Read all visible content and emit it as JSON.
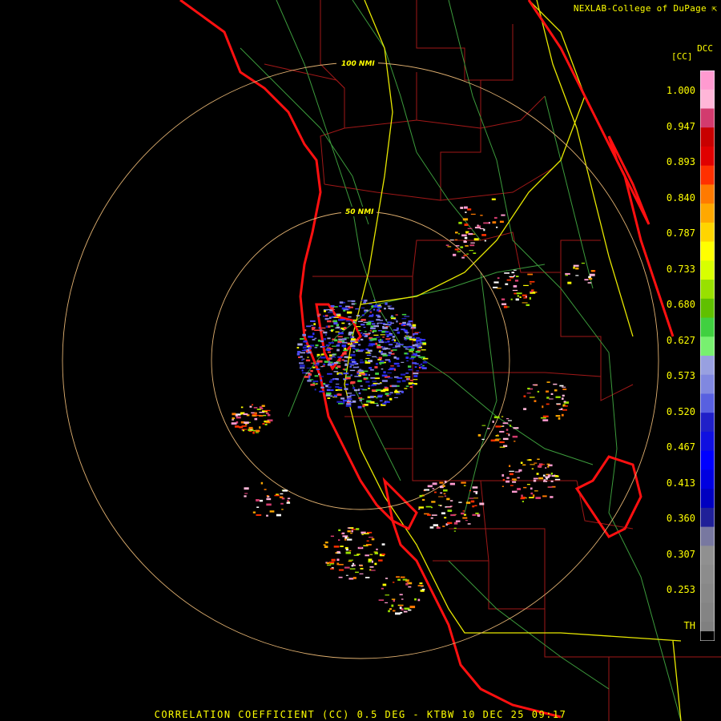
{
  "header": {
    "credit": "NEXLAB-College of DuPage",
    "credit_icon": "cursor-arrow-icon",
    "product_code": "DCC",
    "unit": "[CC]"
  },
  "legend": {
    "labels": [
      "1.000",
      "0.947",
      "0.893",
      "0.840",
      "0.787",
      "0.733",
      "0.680",
      "0.627",
      "0.573",
      "0.520",
      "0.467",
      "0.413",
      "0.360",
      "0.307",
      "0.253",
      "TH"
    ],
    "colors": [
      "#ff9ad0",
      "#ffb6d8",
      "#d23b6e",
      "#c80000",
      "#e00000",
      "#ff3000",
      "#ff7a00",
      "#ffa800",
      "#ffd500",
      "#ffff00",
      "#d8ff00",
      "#98e000",
      "#60c000",
      "#40d040",
      "#78f070",
      "#98a0e0",
      "#8088e0",
      "#5860e0",
      "#2020c8",
      "#1010e0",
      "#0000ff",
      "#0000e0",
      "#0000c0",
      "#202098",
      "#7878a0",
      "#909090",
      "#8c8c8c",
      "#888888",
      "#848484",
      "#808080"
    ],
    "colors_note_start_value": 1.0
  },
  "map": {
    "rings": [
      {
        "label": "50 NMI"
      },
      {
        "label": "100 NMI"
      }
    ]
  },
  "footer": {
    "title": "CORRELATION COEFFICIENT (CC) 0.5 DEG - KTBW 10 DEC 25 09:17"
  }
}
